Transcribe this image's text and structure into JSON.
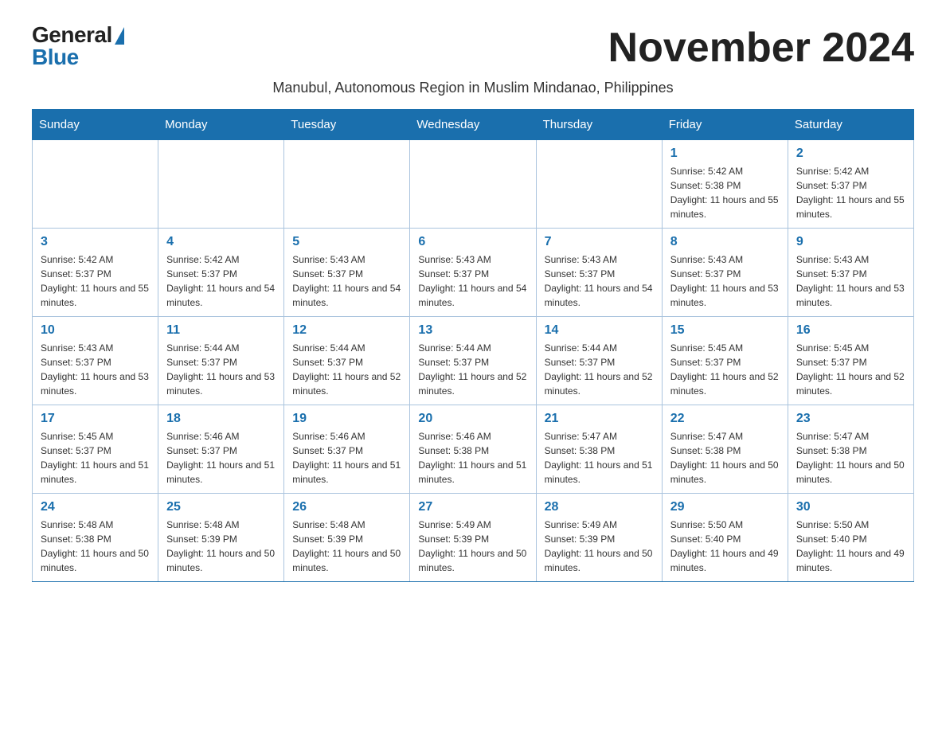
{
  "logo": {
    "general": "General",
    "blue": "Blue",
    "triangle": "▶"
  },
  "title": "November 2024",
  "subtitle": "Manubul, Autonomous Region in Muslim Mindanao, Philippines",
  "days_of_week": [
    "Sunday",
    "Monday",
    "Tuesday",
    "Wednesday",
    "Thursday",
    "Friday",
    "Saturday"
  ],
  "weeks": [
    [
      {
        "day": "",
        "sunrise": "",
        "sunset": "",
        "daylight": ""
      },
      {
        "day": "",
        "sunrise": "",
        "sunset": "",
        "daylight": ""
      },
      {
        "day": "",
        "sunrise": "",
        "sunset": "",
        "daylight": ""
      },
      {
        "day": "",
        "sunrise": "",
        "sunset": "",
        "daylight": ""
      },
      {
        "day": "",
        "sunrise": "",
        "sunset": "",
        "daylight": ""
      },
      {
        "day": "1",
        "sunrise": "Sunrise: 5:42 AM",
        "sunset": "Sunset: 5:38 PM",
        "daylight": "Daylight: 11 hours and 55 minutes."
      },
      {
        "day": "2",
        "sunrise": "Sunrise: 5:42 AM",
        "sunset": "Sunset: 5:37 PM",
        "daylight": "Daylight: 11 hours and 55 minutes."
      }
    ],
    [
      {
        "day": "3",
        "sunrise": "Sunrise: 5:42 AM",
        "sunset": "Sunset: 5:37 PM",
        "daylight": "Daylight: 11 hours and 55 minutes."
      },
      {
        "day": "4",
        "sunrise": "Sunrise: 5:42 AM",
        "sunset": "Sunset: 5:37 PM",
        "daylight": "Daylight: 11 hours and 54 minutes."
      },
      {
        "day": "5",
        "sunrise": "Sunrise: 5:43 AM",
        "sunset": "Sunset: 5:37 PM",
        "daylight": "Daylight: 11 hours and 54 minutes."
      },
      {
        "day": "6",
        "sunrise": "Sunrise: 5:43 AM",
        "sunset": "Sunset: 5:37 PM",
        "daylight": "Daylight: 11 hours and 54 minutes."
      },
      {
        "day": "7",
        "sunrise": "Sunrise: 5:43 AM",
        "sunset": "Sunset: 5:37 PM",
        "daylight": "Daylight: 11 hours and 54 minutes."
      },
      {
        "day": "8",
        "sunrise": "Sunrise: 5:43 AM",
        "sunset": "Sunset: 5:37 PM",
        "daylight": "Daylight: 11 hours and 53 minutes."
      },
      {
        "day": "9",
        "sunrise": "Sunrise: 5:43 AM",
        "sunset": "Sunset: 5:37 PM",
        "daylight": "Daylight: 11 hours and 53 minutes."
      }
    ],
    [
      {
        "day": "10",
        "sunrise": "Sunrise: 5:43 AM",
        "sunset": "Sunset: 5:37 PM",
        "daylight": "Daylight: 11 hours and 53 minutes."
      },
      {
        "day": "11",
        "sunrise": "Sunrise: 5:44 AM",
        "sunset": "Sunset: 5:37 PM",
        "daylight": "Daylight: 11 hours and 53 minutes."
      },
      {
        "day": "12",
        "sunrise": "Sunrise: 5:44 AM",
        "sunset": "Sunset: 5:37 PM",
        "daylight": "Daylight: 11 hours and 52 minutes."
      },
      {
        "day": "13",
        "sunrise": "Sunrise: 5:44 AM",
        "sunset": "Sunset: 5:37 PM",
        "daylight": "Daylight: 11 hours and 52 minutes."
      },
      {
        "day": "14",
        "sunrise": "Sunrise: 5:44 AM",
        "sunset": "Sunset: 5:37 PM",
        "daylight": "Daylight: 11 hours and 52 minutes."
      },
      {
        "day": "15",
        "sunrise": "Sunrise: 5:45 AM",
        "sunset": "Sunset: 5:37 PM",
        "daylight": "Daylight: 11 hours and 52 minutes."
      },
      {
        "day": "16",
        "sunrise": "Sunrise: 5:45 AM",
        "sunset": "Sunset: 5:37 PM",
        "daylight": "Daylight: 11 hours and 52 minutes."
      }
    ],
    [
      {
        "day": "17",
        "sunrise": "Sunrise: 5:45 AM",
        "sunset": "Sunset: 5:37 PM",
        "daylight": "Daylight: 11 hours and 51 minutes."
      },
      {
        "day": "18",
        "sunrise": "Sunrise: 5:46 AM",
        "sunset": "Sunset: 5:37 PM",
        "daylight": "Daylight: 11 hours and 51 minutes."
      },
      {
        "day": "19",
        "sunrise": "Sunrise: 5:46 AM",
        "sunset": "Sunset: 5:37 PM",
        "daylight": "Daylight: 11 hours and 51 minutes."
      },
      {
        "day": "20",
        "sunrise": "Sunrise: 5:46 AM",
        "sunset": "Sunset: 5:38 PM",
        "daylight": "Daylight: 11 hours and 51 minutes."
      },
      {
        "day": "21",
        "sunrise": "Sunrise: 5:47 AM",
        "sunset": "Sunset: 5:38 PM",
        "daylight": "Daylight: 11 hours and 51 minutes."
      },
      {
        "day": "22",
        "sunrise": "Sunrise: 5:47 AM",
        "sunset": "Sunset: 5:38 PM",
        "daylight": "Daylight: 11 hours and 50 minutes."
      },
      {
        "day": "23",
        "sunrise": "Sunrise: 5:47 AM",
        "sunset": "Sunset: 5:38 PM",
        "daylight": "Daylight: 11 hours and 50 minutes."
      }
    ],
    [
      {
        "day": "24",
        "sunrise": "Sunrise: 5:48 AM",
        "sunset": "Sunset: 5:38 PM",
        "daylight": "Daylight: 11 hours and 50 minutes."
      },
      {
        "day": "25",
        "sunrise": "Sunrise: 5:48 AM",
        "sunset": "Sunset: 5:39 PM",
        "daylight": "Daylight: 11 hours and 50 minutes."
      },
      {
        "day": "26",
        "sunrise": "Sunrise: 5:48 AM",
        "sunset": "Sunset: 5:39 PM",
        "daylight": "Daylight: 11 hours and 50 minutes."
      },
      {
        "day": "27",
        "sunrise": "Sunrise: 5:49 AM",
        "sunset": "Sunset: 5:39 PM",
        "daylight": "Daylight: 11 hours and 50 minutes."
      },
      {
        "day": "28",
        "sunrise": "Sunrise: 5:49 AM",
        "sunset": "Sunset: 5:39 PM",
        "daylight": "Daylight: 11 hours and 50 minutes."
      },
      {
        "day": "29",
        "sunrise": "Sunrise: 5:50 AM",
        "sunset": "Sunset: 5:40 PM",
        "daylight": "Daylight: 11 hours and 49 minutes."
      },
      {
        "day": "30",
        "sunrise": "Sunrise: 5:50 AM",
        "sunset": "Sunset: 5:40 PM",
        "daylight": "Daylight: 11 hours and 49 minutes."
      }
    ]
  ]
}
